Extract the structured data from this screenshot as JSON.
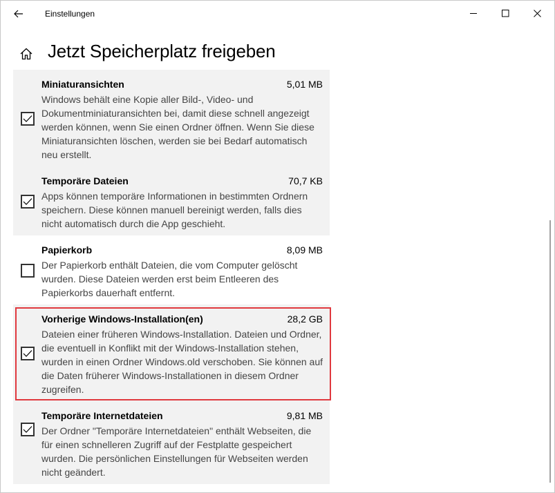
{
  "window": {
    "title": "Einstellungen",
    "buttons": [
      "minimize-icon",
      "maximize-icon",
      "close-icon"
    ]
  },
  "header": {
    "title": "Jetzt Speicherplatz freigeben",
    "home_icon": "home-icon",
    "back_icon": "arrow-left-icon"
  },
  "items": [
    {
      "name": "Miniaturansichten",
      "size": "5,01 MB",
      "checked": true,
      "desc": "Windows behält eine Kopie aller Bild-, Video- und Dokumentminiaturansichten bei, damit diese schnell angezeigt werden können, wenn Sie einen Ordner öffnen. Wenn Sie diese Miniaturansichten löschen, werden sie bei Bedarf automatisch neu erstellt."
    },
    {
      "name": "Temporäre Dateien",
      "size": "70,7 KB",
      "checked": true,
      "desc": "Apps können temporäre Informationen in bestimmten Ordnern speichern. Diese können manuell bereinigt werden, falls dies nicht automatisch durch die App geschieht."
    },
    {
      "name": "Papierkorb",
      "size": "8,09 MB",
      "checked": false,
      "desc": "Der Papierkorb enthält Dateien, die vom Computer gelöscht wurden. Diese Dateien werden erst beim Entleeren des Papierkorbs dauerhaft entfernt."
    },
    {
      "name": "Vorherige Windows-Installation(en)",
      "size": "28,2 GB",
      "checked": true,
      "highlighted": true,
      "desc": "Dateien einer früheren Windows-Installation. Dateien und Ordner, die eventuell in Konflikt mit der Windows-Installation stehen, wurden in einen Ordner Windows.old verschoben. Sie können auf die Daten früherer Windows-Installationen in diesem Ordner zugreifen."
    },
    {
      "name": "Temporäre Internetdateien",
      "size": "9,81 MB",
      "checked": true,
      "desc": "Der Ordner \"Temporäre Internetdateien\" enthält Webseiten, die für einen schnelleren Zugriff auf der Festplatte gespeichert wurden. Die persönlichen Einstellungen für Webseiten werden nicht geändert."
    }
  ],
  "colors": {
    "item_bg": "#f2f2f2",
    "highlight_border": "#e0383e"
  }
}
